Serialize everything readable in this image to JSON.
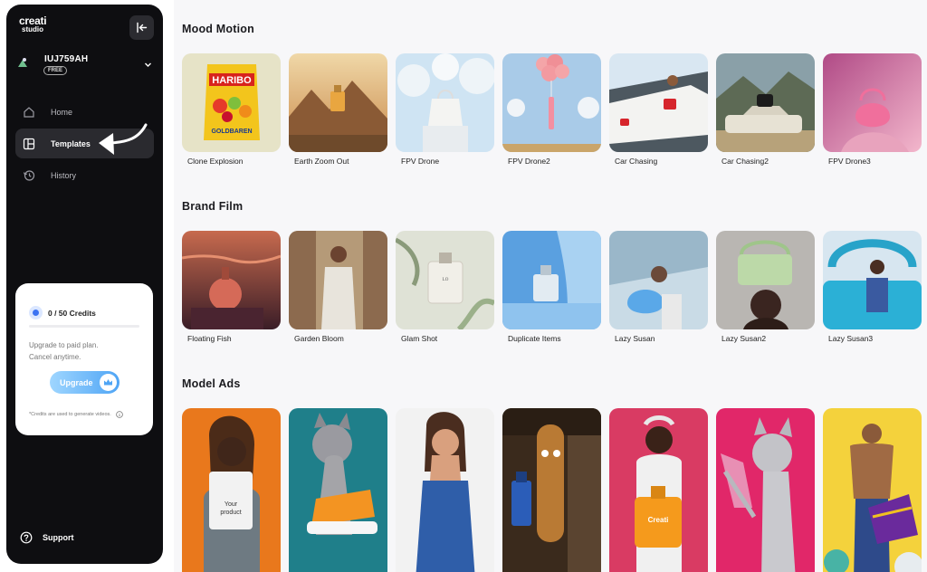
{
  "app": {
    "logo_line1": "creati",
    "logo_line2": "studio"
  },
  "user": {
    "name": "IUJ759AH",
    "plan": "FREE"
  },
  "nav": [
    {
      "label": "Home",
      "icon": "home-icon"
    },
    {
      "label": "Templates",
      "icon": "templates-icon",
      "active": true
    },
    {
      "label": "History",
      "icon": "history-icon"
    }
  ],
  "credits": {
    "label": "0 / 50 Credits",
    "used": 0,
    "total": 50,
    "upgrade_line1": "Upgrade to paid plan.",
    "upgrade_line2": "Cancel anytime.",
    "upgrade_button": "Upgrade",
    "note": "*Credits are used to generate videos."
  },
  "support": {
    "label": "Support"
  },
  "sections": [
    {
      "title": "Mood Motion",
      "items": [
        "Clone Explosion",
        "Earth Zoom Out",
        "FPV Drone",
        "FPV Drone2",
        "Car Chasing",
        "Car Chasing2",
        "FPV Drone3"
      ]
    },
    {
      "title": "Brand Film",
      "items": [
        "Floating Fish",
        "Garden Bloom",
        "Glam Shot",
        "Duplicate Items",
        "Lazy Susan",
        "Lazy Susan2",
        "Lazy Susan3"
      ]
    },
    {
      "title": "Model Ads",
      "items": [
        "",
        "",
        "",
        "",
        "",
        "",
        ""
      ],
      "thumb_text": {
        "product_line1": "Your",
        "product_line2": "product",
        "bottle_brand": "Creati",
        "haribo_line1": "HARIBO",
        "haribo_line2": "GOLDBAREN"
      }
    }
  ],
  "colors": {
    "sidebar_bg": "#0e0e11",
    "accent": "#3c73f2",
    "upgrade_gradient_start": "#9fd6ff",
    "upgrade_gradient_end": "#4fa5f5"
  }
}
